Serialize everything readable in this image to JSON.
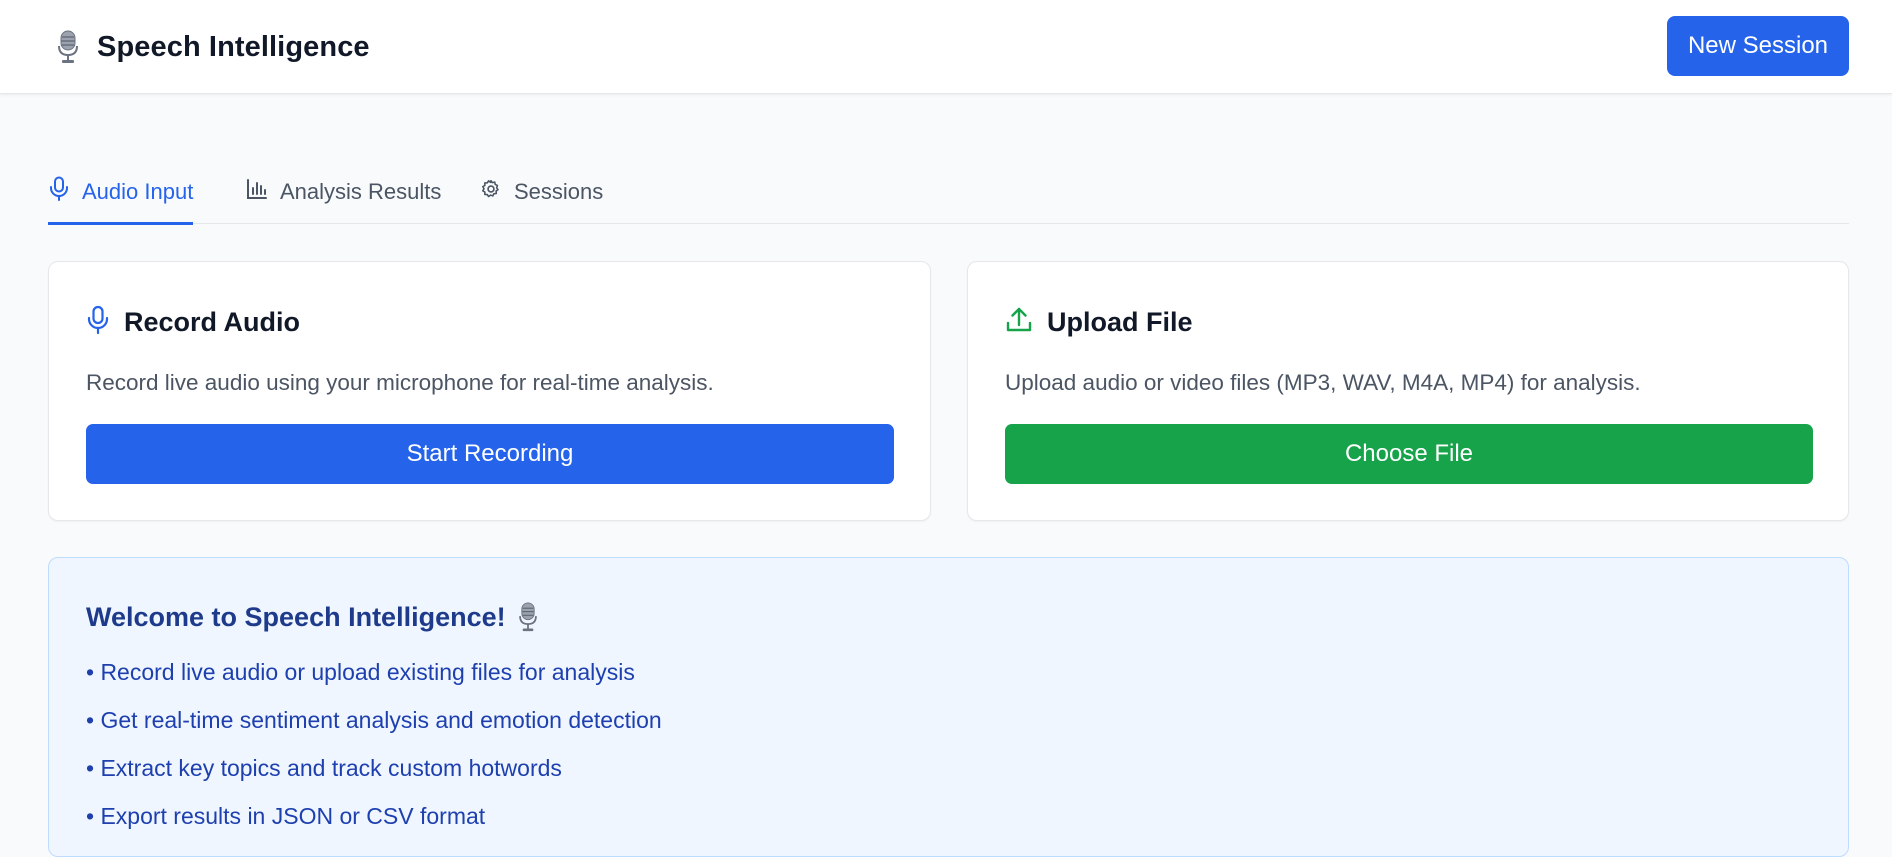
{
  "header": {
    "title": "Speech Intelligence",
    "logo_icon": "studio-microphone-icon",
    "new_session_label": "New Session"
  },
  "tabs": [
    {
      "label": "Audio Input",
      "icon": "microphone-icon",
      "active": true
    },
    {
      "label": "Analysis Results",
      "icon": "bar-chart-icon",
      "active": false
    },
    {
      "label": "Sessions",
      "icon": "gear-icon",
      "active": false
    }
  ],
  "record_card": {
    "icon": "microphone-icon",
    "title": "Record Audio",
    "description": "Record live audio using your microphone for real-time analysis.",
    "button_label": "Start Recording"
  },
  "upload_card": {
    "icon": "upload-icon",
    "title": "Upload File",
    "description": "Upload audio or video files (MP3, WAV, M4A, MP4) for analysis.",
    "button_label": "Choose File"
  },
  "welcome": {
    "title": "Welcome to Speech Intelligence!",
    "title_icon": "studio-microphone-icon",
    "items": [
      "• Record live audio or upload existing files for analysis",
      "• Get real-time sentiment analysis and emotion detection",
      "• Extract key topics and track custom hotwords",
      "• Export results in JSON or CSV format"
    ]
  },
  "colors": {
    "primary": "#2563eb",
    "success": "#16a34a",
    "background": "#f8fafc",
    "info_bg": "#eff6ff",
    "info_text": "#1e40af"
  }
}
